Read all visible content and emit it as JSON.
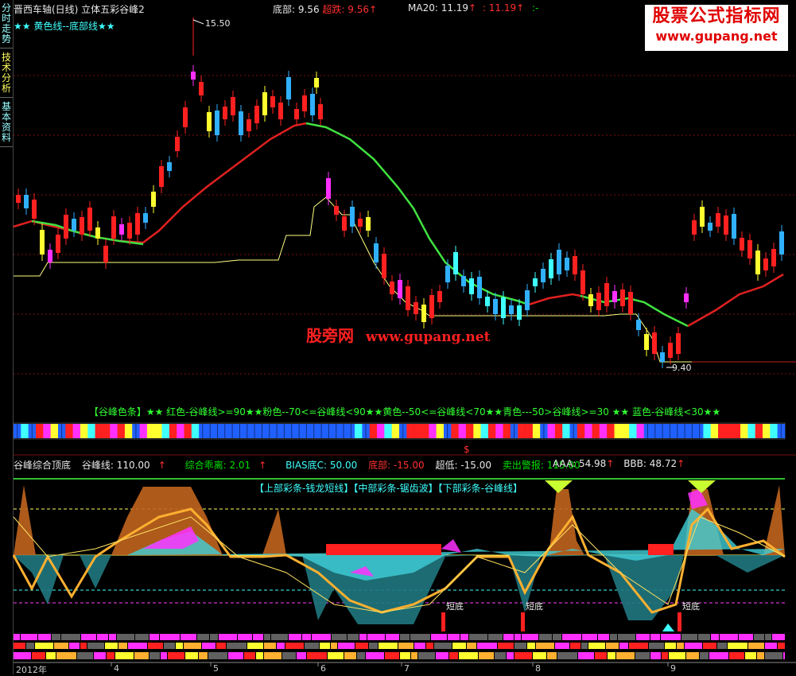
{
  "sidebar": {
    "tabs": [
      {
        "label": "分时走势"
      },
      {
        "label": "技术分析"
      },
      {
        "label": "基本资料"
      }
    ]
  },
  "header": {
    "title": "晋西车轴(日线) 立体五彩谷峰2",
    "subtitle": "★★ 黄色线--底部线★★",
    "bottom_label": "底部: 9.56",
    "bottom_value_label": "超跌: 9.56",
    "ma_label": "MA20: 11.19",
    "ma_value2": ": 11.19",
    "ma_tail": ":-"
  },
  "watermark": {
    "line1": "股票公式指标网",
    "line2": "www.gupang.net"
  },
  "main_chart": {
    "high_label": "15.50",
    "low_label": "9.40",
    "center_brand": "股旁网",
    "center_url": "www.gupang.net"
  },
  "color_bar_legend": "【谷峰色条】★★ 红色-谷峰线>=90★★粉色--70<=谷峰线<90★★黄色--50<=谷峰线<70★★青色---50>谷峰线>=30 ★★ 蓝色-谷峰线<30★★",
  "s_marker": "$",
  "indicator": {
    "name": "谷峰综合顶底",
    "gf_label": "谷峰线: 110.00",
    "zh_label": "综合乖离: 2.01",
    "bias_label": "BIAS底C: 50.00",
    "bottom_label": "底部: -15.00",
    "chaodi_label": "超低: -15.00",
    "sell_label": "卖出警报: 115.00",
    "aaa_label": "AAA: 54.98",
    "bbb_label": "BBB: 48.72",
    "inner_legend": "【上部彩条-钱龙短线】【中部彩条-锯齿波】【下部彩条-谷峰线】",
    "short_bottom": "短底"
  },
  "xaxis": {
    "labels": [
      "2012年",
      "4",
      "5",
      "6",
      "7",
      "8",
      "9"
    ]
  },
  "colors": {
    "up": "#ff2020",
    "down": "#30b0ff",
    "ma_red": "#e02020",
    "ma_green": "#40e040",
    "support": "#ffff80"
  }
}
